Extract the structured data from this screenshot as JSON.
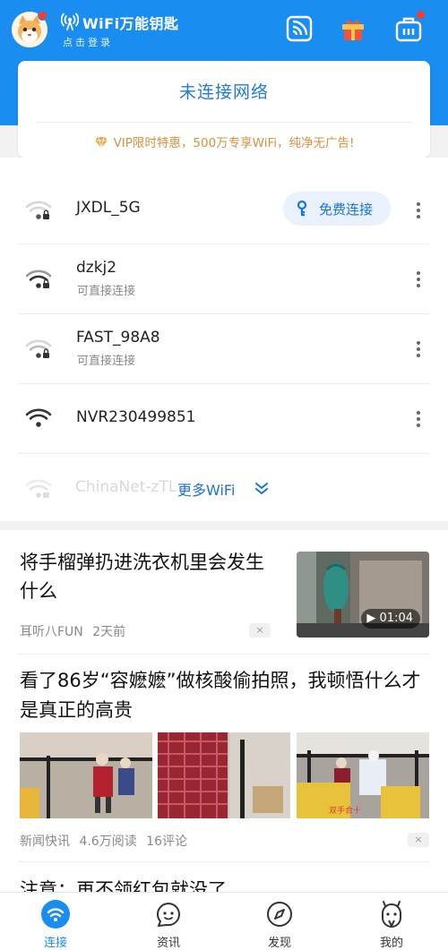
{
  "header": {
    "app_title": "WiFi万能钥匙",
    "login_text": "点击登录",
    "icons": [
      "avatar",
      "wifi-logo-icon",
      "cast-icon",
      "gift-icon",
      "toolbox-icon"
    ]
  },
  "status": {
    "text": "未连接网络",
    "vip_promo": "VIP限时特惠，500万专享WiFi，纯净无广告!"
  },
  "wifi_list": [
    {
      "name": "JXDL_5G",
      "subtitle": "",
      "button": "免费连接",
      "locked": true
    },
    {
      "name": "dzkj2",
      "subtitle": "可直接连接",
      "locked": true
    },
    {
      "name": "FAST_98A8",
      "subtitle": "可直接连接",
      "locked": true
    },
    {
      "name": "NVR230499851",
      "subtitle": "",
      "locked": false
    },
    {
      "name": "ChinaNet-zTL",
      "subtitle": "",
      "faded": true
    }
  ],
  "more_wifi_label": "更多WiFi",
  "feed": [
    {
      "title": "将手榴弹扔进洗衣机里会发生什么",
      "source": "耳听八FUN",
      "time": "2天前",
      "duration": "01:04",
      "close": "×"
    },
    {
      "title": "看了86岁“容嬷嬷”做核酸偷拍照，我顿悟什么才是真正的高贵",
      "source": "新闻快讯",
      "reads": "4.6万阅读",
      "comments": "16评论",
      "caption": "双手合十",
      "close": "×"
    },
    {
      "title": "注意：再不领红包就没了"
    }
  ],
  "tabs": [
    {
      "label": "连接",
      "active": true
    },
    {
      "label": "资讯"
    },
    {
      "label": "发现"
    },
    {
      "label": "我的"
    }
  ],
  "colors": {
    "primary": "#1a8df0",
    "badge_red": "#f23d30",
    "vip_gold": "#d9903f"
  }
}
